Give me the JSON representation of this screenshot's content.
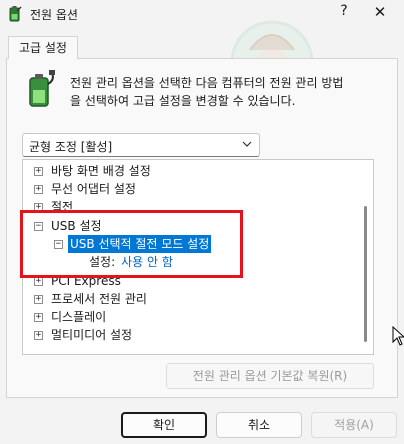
{
  "window": {
    "title": "전원 옵션",
    "help_glyph": "?",
    "close_glyph": "✕"
  },
  "tab": {
    "label": "고급 설정"
  },
  "description": "전원 관리 옵션을 선택한 다음 컴퓨터의 전원 관리 방법을 선택하여 고급 설정을 변경할 수 있습니다.",
  "plan_select": {
    "value": "균형 조정 [활성]"
  },
  "tree": {
    "items": [
      {
        "expander": "+",
        "label": "바탕 화면 배경 설정"
      },
      {
        "expander": "+",
        "label": "무선 어댑터 설정"
      },
      {
        "expander": "+",
        "label": "절전"
      },
      {
        "expander": "−",
        "label": "USB 설정"
      },
      {
        "expander": "−",
        "label": "USB 선택적 절전 모드 설정"
      },
      {
        "setting_key": "설정:",
        "setting_value": "사용 안 함"
      },
      {
        "expander": "+",
        "label": "PCI Express"
      },
      {
        "expander": "+",
        "label": "프로세서 전원 관리"
      },
      {
        "expander": "+",
        "label": "디스플레이"
      },
      {
        "expander": "+",
        "label": "멀티미디어 설정"
      }
    ]
  },
  "restore_defaults_label": "전원 관리 옵션 기본값 복원(R)",
  "buttons": {
    "ok": "확인",
    "cancel": "취소",
    "apply": "적용(A)"
  },
  "colors": {
    "highlight_border": "#e5141b",
    "selection": "#0078d4",
    "setting_value": "#0064c8"
  }
}
